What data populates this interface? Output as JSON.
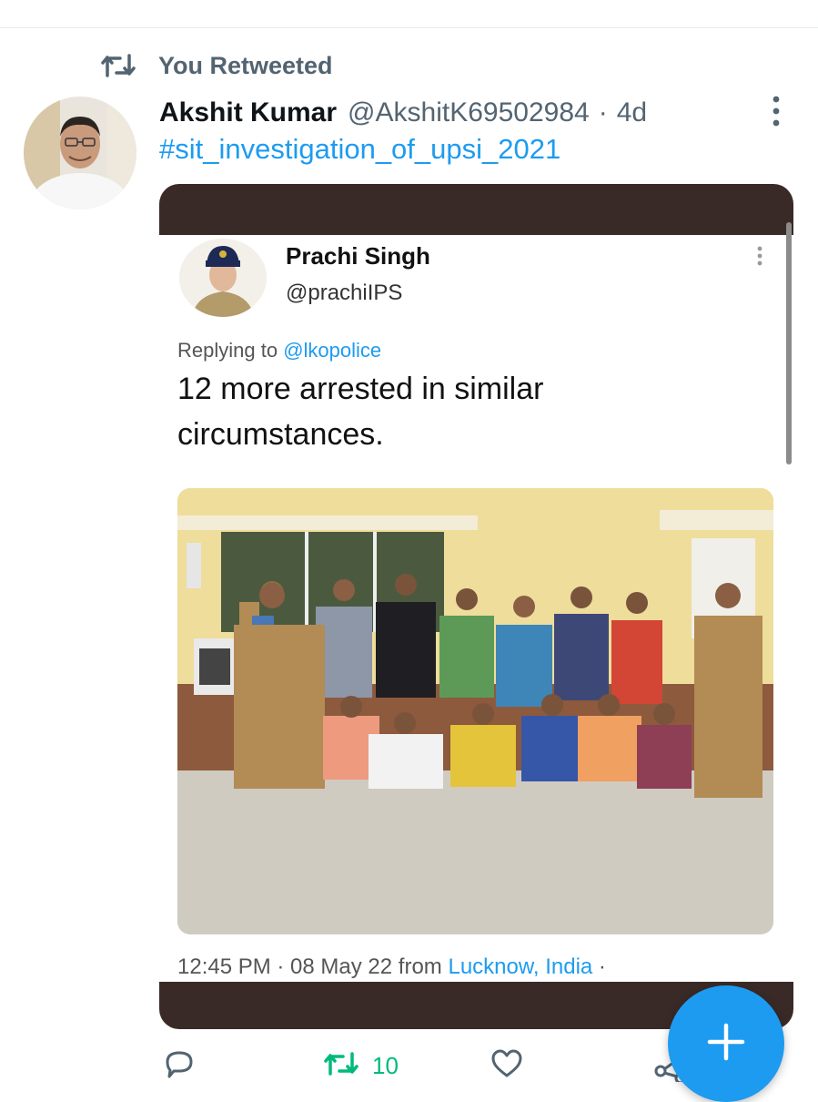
{
  "colors": {
    "accent": "#1d9bf0",
    "retweet_green": "#00ba7c",
    "secondary_text": "#536471"
  },
  "retweet_banner": {
    "icon": "retweet-icon",
    "label": "You Retweeted"
  },
  "tweet": {
    "author_name": "Akshit Kumar",
    "author_handle": "@AkshitK69502984",
    "separator": "·",
    "time": "4d",
    "hashtag": "#sit_investigation_of_upsi_2021"
  },
  "embedded_screenshot": {
    "name": "Prachi Singh",
    "handle": "@prachiIPS",
    "replying_prefix": "Replying to ",
    "replying_to": "@lkopolice",
    "text": "12 more arrested in similar circumstances.",
    "meta_prefix": "12:45 PM · 08 May 22 from ",
    "location": "Lucknow, India",
    "meta_suffix": " ·"
  },
  "actions": {
    "reply_icon": "reply-icon",
    "retweet_icon": "retweet-icon",
    "retweet_count": "10",
    "like_icon": "heart-icon",
    "share_icon": "share-icon"
  },
  "fab": {
    "icon": "plus-icon"
  }
}
